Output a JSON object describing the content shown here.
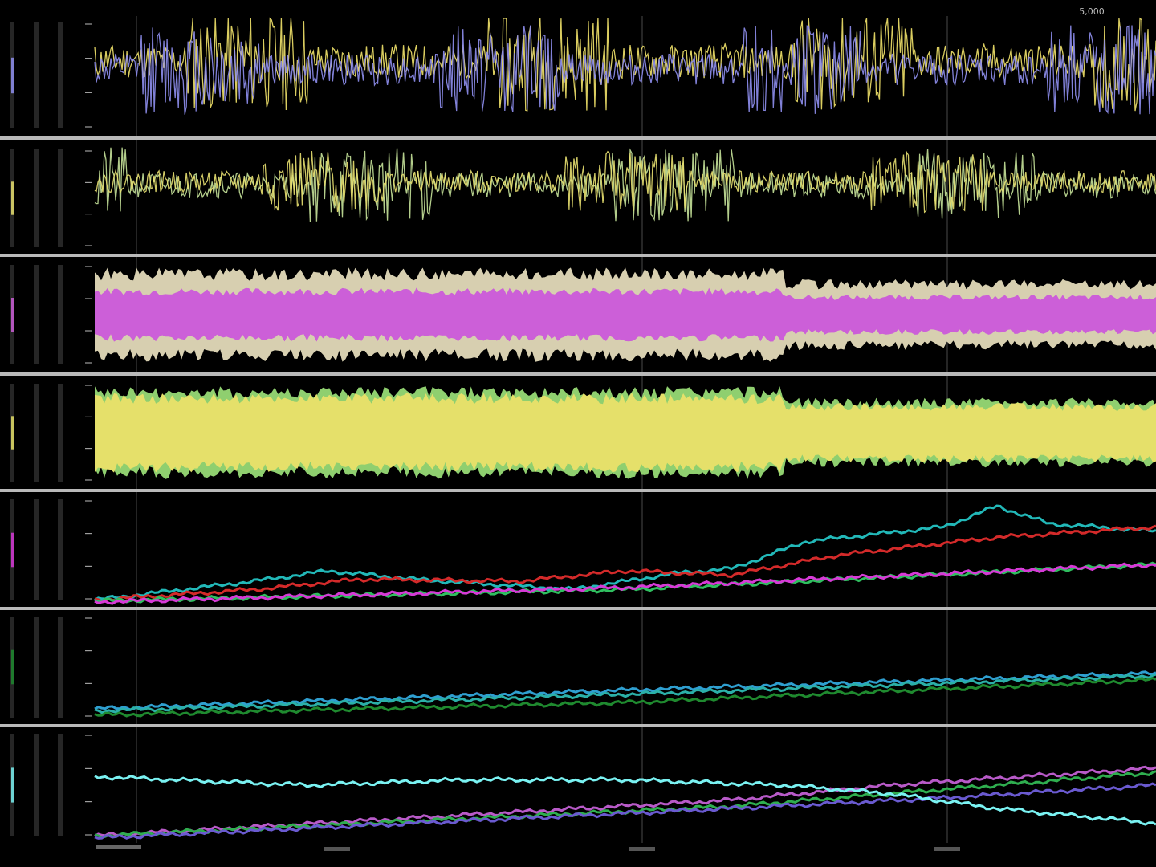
{
  "theme": {
    "background": "#000000",
    "separator": "#b9b9b9",
    "gridline": "#4a4a4a",
    "axis_text": "#bdbdbd"
  },
  "top_right_label": "5,000",
  "chart_data": [
    {
      "type": "line",
      "signal": "oscillating",
      "series": [
        {
          "color": "#f2e36a",
          "baseline": 0.62,
          "amp": 0.42,
          "seed": 11
        },
        {
          "color": "#8f8ff0",
          "baseline": 0.55,
          "amp": 0.38,
          "seed": 12
        }
      ]
    },
    {
      "type": "line",
      "signal": "oscillating",
      "series": [
        {
          "color": "#c7e39a",
          "baseline": 0.62,
          "amp": 0.34,
          "seed": 21
        },
        {
          "color": "#e8e070",
          "baseline": 0.65,
          "amp": 0.28,
          "seed": 22
        }
      ]
    },
    {
      "type": "area",
      "signal": "envelope",
      "series": [
        {
          "color": "#d7cfb0",
          "amp": 0.42,
          "seed": 31
        },
        {
          "color": "#cc5fd8",
          "amp": 0.24,
          "seed": 32
        }
      ]
    },
    {
      "type": "area",
      "signal": "envelope",
      "series": [
        {
          "color": "#8fcf6f",
          "amp": 0.42,
          "seed": 41
        },
        {
          "color": "#e5e06a",
          "amp": 0.36,
          "seed": 42
        }
      ]
    },
    {
      "type": "line",
      "signal": "trend",
      "series": [
        {
          "color": "#22b8b8",
          "points": [
            [
              0,
              0.02
            ],
            [
              0.15,
              0.2
            ],
            [
              0.22,
              0.3
            ],
            [
              0.3,
              0.22
            ],
            [
              0.45,
              0.12
            ],
            [
              0.55,
              0.28
            ],
            [
              0.6,
              0.32
            ],
            [
              0.67,
              0.58
            ],
            [
              0.8,
              0.72
            ],
            [
              0.85,
              0.92
            ],
            [
              0.9,
              0.75
            ],
            [
              1,
              0.68
            ]
          ]
        },
        {
          "color": "#d42a2a",
          "points": [
            [
              0,
              0.02
            ],
            [
              0.15,
              0.12
            ],
            [
              0.25,
              0.22
            ],
            [
              0.4,
              0.2
            ],
            [
              0.5,
              0.3
            ],
            [
              0.6,
              0.26
            ],
            [
              0.7,
              0.45
            ],
            [
              0.85,
              0.62
            ],
            [
              1,
              0.72
            ]
          ]
        },
        {
          "color": "#2fbf5f",
          "points": [
            [
              0,
              0.01
            ],
            [
              0.5,
              0.12
            ],
            [
              1,
              0.36
            ]
          ]
        },
        {
          "color": "#d73ad7",
          "points": [
            [
              0,
              0.0
            ],
            [
              0.5,
              0.14
            ],
            [
              1,
              0.36
            ]
          ]
        }
      ]
    },
    {
      "type": "line",
      "signal": "trend",
      "series": [
        {
          "color": "#2f9fd0",
          "points": [
            [
              0,
              0.1
            ],
            [
              0.5,
              0.28
            ],
            [
              1,
              0.44
            ]
          ]
        },
        {
          "color": "#2bb0a8",
          "points": [
            [
              0,
              0.08
            ],
            [
              0.5,
              0.24
            ],
            [
              1,
              0.42
            ]
          ]
        },
        {
          "color": "#1f8a2f",
          "points": [
            [
              0,
              0.04
            ],
            [
              0.5,
              0.16
            ],
            [
              1,
              0.38
            ]
          ]
        }
      ]
    },
    {
      "type": "line",
      "signal": "trend",
      "series": [
        {
          "color": "#b85ac8",
          "points": [
            [
              0,
              0.02
            ],
            [
              0.6,
              0.36
            ],
            [
              0.75,
              0.5
            ],
            [
              1,
              0.66
            ]
          ]
        },
        {
          "color": "#2fae4f",
          "points": [
            [
              0,
              0.02
            ],
            [
              0.6,
              0.3
            ],
            [
              0.75,
              0.42
            ],
            [
              1,
              0.62
            ]
          ]
        },
        {
          "color": "#6a5ad0",
          "points": [
            [
              0,
              0.0
            ],
            [
              0.6,
              0.28
            ],
            [
              0.8,
              0.38
            ],
            [
              1,
              0.5
            ]
          ]
        },
        {
          "color": "#7af2f2",
          "points": [
            [
              0,
              0.58
            ],
            [
              0.2,
              0.5
            ],
            [
              0.35,
              0.55
            ],
            [
              0.5,
              0.55
            ],
            [
              0.65,
              0.5
            ],
            [
              0.75,
              0.42
            ],
            [
              0.85,
              0.28
            ],
            [
              1,
              0.14
            ]
          ]
        }
      ]
    }
  ]
}
